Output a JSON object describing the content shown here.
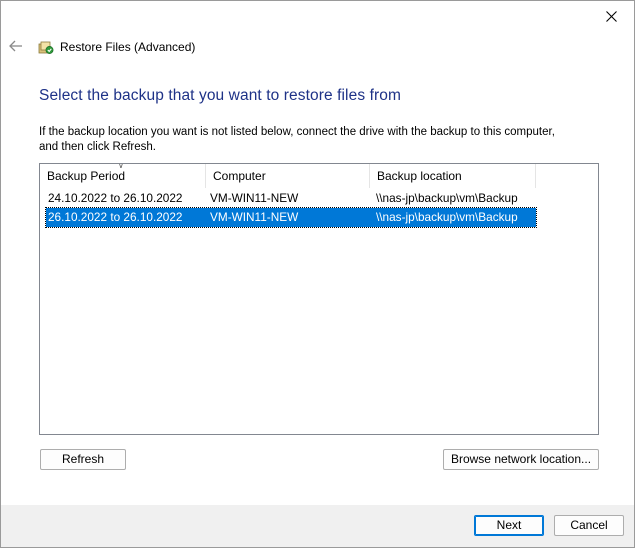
{
  "window": {
    "title": "Restore Files (Advanced)",
    "icons": {
      "back": "back-arrow-icon",
      "close": "close-icon",
      "app": "restore-files-icon"
    }
  },
  "heading": "Select the backup that you want to restore files from",
  "instruction": "If the backup location you want is not listed below, connect the drive with the backup to this computer, and then click Refresh.",
  "table": {
    "columns": [
      "Backup Period",
      "Computer",
      "Backup location"
    ],
    "sorted_column": "Backup Period",
    "rows": [
      {
        "period": "24.10.2022 to 26.10.2022",
        "computer": "VM-WIN11-NEW",
        "location": "\\\\nas-jp\\backup\\vm\\Backup",
        "selected": false
      },
      {
        "period": "26.10.2022 to 26.10.2022",
        "computer": "VM-WIN11-NEW",
        "location": "\\\\nas-jp\\backup\\vm\\Backup",
        "selected": true
      }
    ]
  },
  "buttons": {
    "refresh": "Refresh",
    "browse": "Browse network location...",
    "next": "Next",
    "cancel": "Cancel"
  },
  "colors": {
    "heading": "#1e3287",
    "selection": "#0078d7",
    "footer": "#f0f0f0"
  }
}
